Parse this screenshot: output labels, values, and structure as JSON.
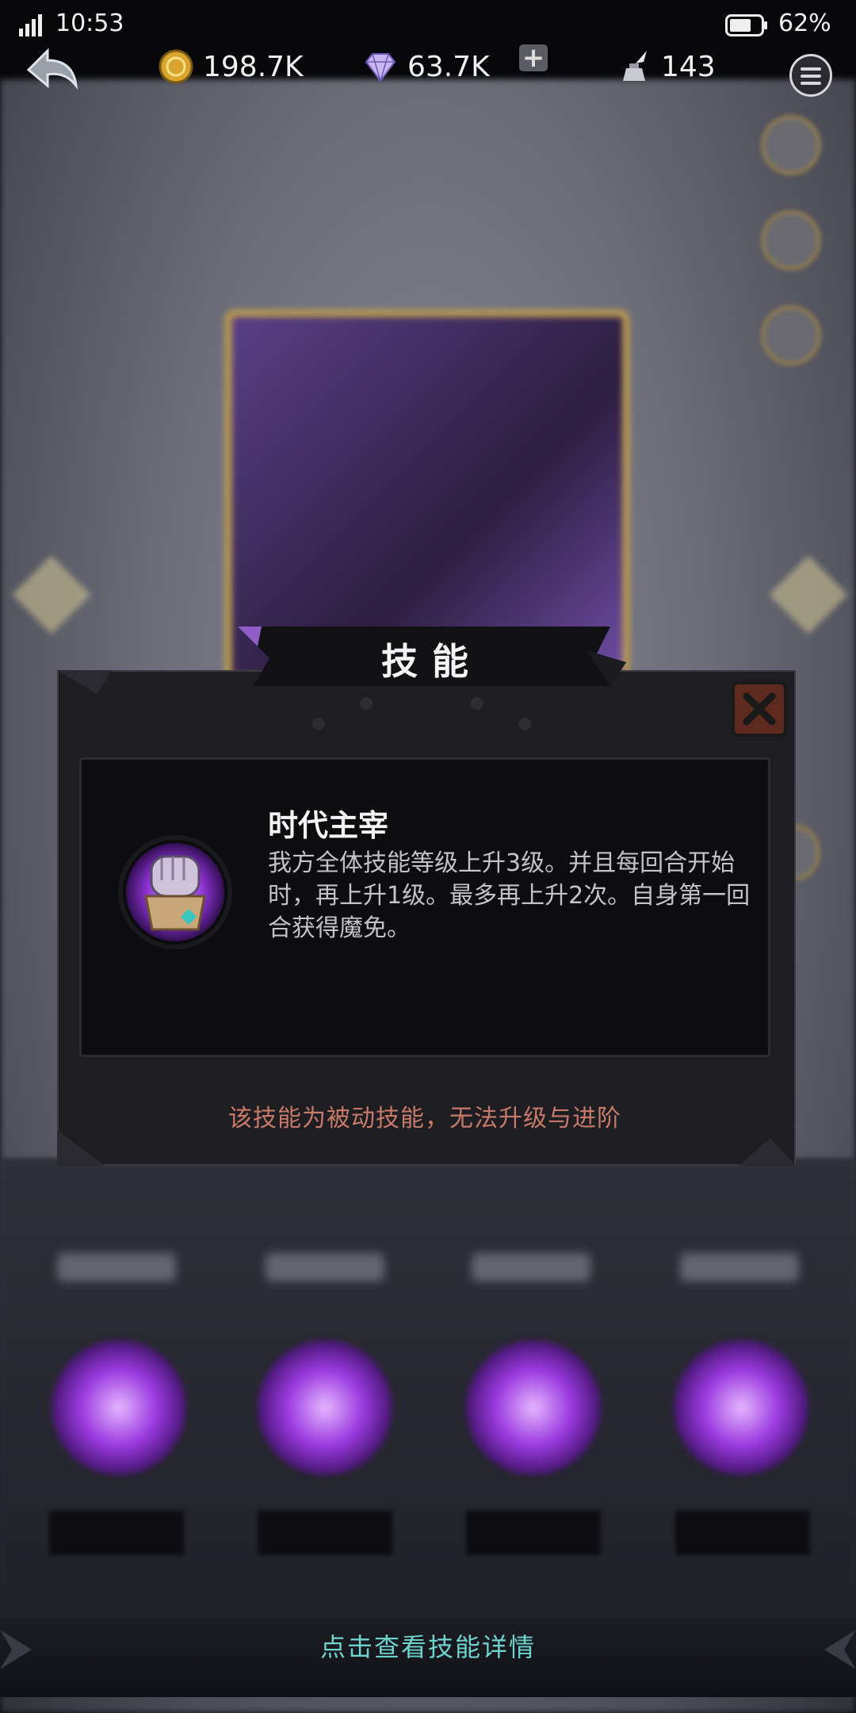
{
  "status_bar": {
    "time": "10:53",
    "battery": "62%"
  },
  "resources": {
    "gold": "198.7K",
    "gems": "63.7K",
    "ink": "143"
  },
  "dialog": {
    "banner_title": "技能",
    "skill_name": "时代主宰",
    "skill_description": "我方全体技能等级上升3级。并且每回合开始时，再上升1级。最多再上升2次。自身第一回合获得魔免。",
    "note": "该技能为被动技能，无法升级与进阶"
  },
  "bottom_hint": "点击查看技能详情",
  "colors": {
    "note_red": "#c87a6a",
    "hint_teal": "#6ed3cf",
    "gold_frame": "#b49653"
  }
}
